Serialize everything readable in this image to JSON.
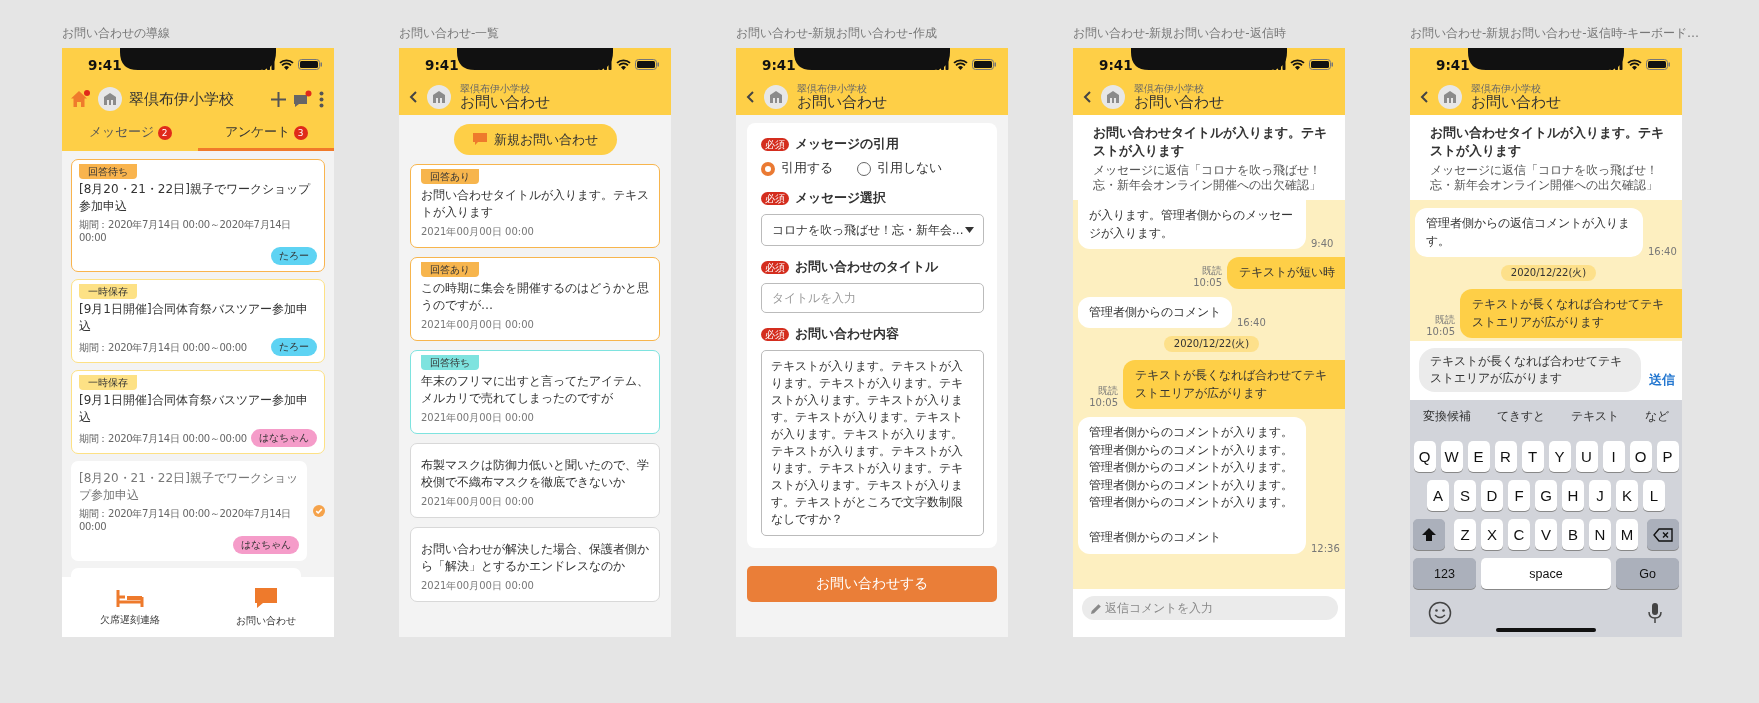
{
  "screens": [
    {
      "kind": "survey_home",
      "caption": "お問い合わせの導線",
      "time": "9:41",
      "school": "翠倶布伊小学校",
      "home_alert": true,
      "chat_alert": true,
      "tabs": [
        {
          "label": "メッセージ",
          "badge": "2",
          "selected": false
        },
        {
          "label": "アンケート",
          "badge": "3",
          "selected": true
        }
      ],
      "cards": [
        {
          "status": "回答待ち",
          "color": "#f9b44e",
          "title": "[8月20・21・22日]親子でワークショップ参加申込",
          "period": "期間：2020年7月14日 00:00～2020年7月14日 00:00",
          "tag": {
            "label": "たろー",
            "color": "#5ed3f3"
          },
          "answered": false
        },
        {
          "status": "一時保存",
          "color": "#fde185",
          "title": "[9月1日開催]合同体育祭バスツアー参加申込",
          "period": "期間：2020年7月14日 00:00～00:00",
          "tag": {
            "label": "たろー",
            "color": "#5ed3f3"
          },
          "answered": false
        },
        {
          "status": "一時保存",
          "color": "#fde185",
          "title": "[9月1日開催]合同体育祭バスツアー参加申込",
          "period": "期間：2020年7月14日 00:00～00:00",
          "tag": {
            "label": "はなちゃん",
            "color": "#f59cc9"
          },
          "answered": false
        },
        {
          "title": "[8月20・21・22日]親子でワークショップ参加申込",
          "period": "期間：2020年7月14日 00:00～2020年7月14日 00:00",
          "tag": {
            "label": "はなちゃん",
            "color": "#f59cc9"
          },
          "answered": true
        }
      ],
      "nav": [
        {
          "kind": "bed",
          "label": "欠席遅刻連絡"
        },
        {
          "kind": "chat",
          "label": "お問い合わせ"
        }
      ]
    },
    {
      "kind": "inquiry_list",
      "caption": "お問い合わせ-一覧",
      "time": "9:41",
      "school": "翠倶布伊小学校",
      "title": "お問い合わせ",
      "new_button": "新規お問い合わせ",
      "items": [
        {
          "status": "回答あり",
          "color": "#f7b54d",
          "title": "お問い合わせタイトルが入ります。テキストが入ります",
          "date": "2021年00月00日 00:00"
        },
        {
          "status": "回答あり",
          "color": "#f7b54d",
          "title": "この時期に集会を開催するのはどうかと思うのですが…",
          "date": "2021年00月00日 00:00"
        },
        {
          "status": "回答待ち",
          "color": "#7ee3df",
          "title": "年末のフリマに出すと言ってたアイテム、メルカリで売れてしまったのですが",
          "date": "2021年00月00日 00:00"
        },
        {
          "title": "布製マスクは防御力低いと聞いたので、学校側で不織布マスクを徹底できないか",
          "date": "2021年00月00日 00:00"
        },
        {
          "title": "お問い合わせが解決した場合、保護者側から「解決」とするかエンドレスなのか",
          "date": "2021年00月00日 00:00"
        }
      ]
    },
    {
      "kind": "form",
      "caption": "お問い合わせ-新規お問い合わせ-作成",
      "time": "9:41",
      "school": "翠倶布伊小学校",
      "title": "お問い合わせ",
      "fields": [
        {
          "kind": "radio",
          "required": "必須",
          "label": "メッセージの引用",
          "options": [
            {
              "label": "引用する",
              "selected": true
            },
            {
              "label": "引用しない",
              "selected": false
            }
          ]
        },
        {
          "kind": "select",
          "required": "必須",
          "label": "メッセージ選択",
          "value": "コロナを吹っ飛ばせ！忘・新年会..."
        },
        {
          "kind": "input",
          "required": "必須",
          "label": "お問い合わせのタイトル",
          "placeholder": "タイトルを入力"
        },
        {
          "kind": "textarea",
          "required": "必須",
          "label": "お問い合わせ内容",
          "value": "テキストが入ります。テキストが入ります。テキストが入ります。テキストが入ります。テキストが入ります。テキストが入ります。テキストが入ります。テキストが入ります。テキストが入ります。テキストが入ります。テキストが入ります。テキストが入ります。テキストが入ります。テキストがところで文字数制限なしですか？"
        }
      ],
      "submit": "お問い合わせする"
    },
    {
      "kind": "chat",
      "caption": "お問い合わせ-新規お問い合わせ-返信時",
      "time": "9:41",
      "school": "翠倶布伊小学校",
      "title": "お問い合わせ",
      "topic": {
        "title": "お問い合わせタイトルが入ります。テキストが入ります",
        "reply_to": "メッセージに返信「コロナを吹っ飛ばせ！忘・新年会オンライン開催への出欠確認」"
      },
      "messages": [
        {
          "kind": "received",
          "paragraphs": [
            "が入ります。管理者側からのメッセージが入ります。"
          ],
          "time": "9:40"
        },
        {
          "kind": "sent",
          "text": "テキストが短い時",
          "read": "既読",
          "time": "10:05"
        },
        {
          "kind": "received",
          "paragraphs": [
            "管理者側からのコメント"
          ],
          "time": "16:40"
        },
        {
          "kind": "date",
          "text": "2020/12/22(火)"
        },
        {
          "kind": "sent",
          "text": "テキストが長くなれば合わせてテキストエリアが広がります",
          "read": "既読",
          "time": "10:05"
        },
        {
          "kind": "received",
          "paragraphs": [
            "管理者側からのコメントが入ります。管理者側からのコメントが入ります。管理者側からのコメントが入ります。管理者側からのコメントが入ります。管理者側からのコメントが入ります。",
            "管理者側からのコメント"
          ],
          "time": "12:36"
        }
      ],
      "compose": {
        "placeholder": "返信コメントを入力"
      }
    },
    {
      "kind": "chat",
      "caption": "お問い合わせ-新規お問い合わせ-返信時-キーボード…",
      "time": "9:41",
      "school": "翠倶布伊小学校",
      "title": "お問い合わせ",
      "topic": {
        "title": "お問い合わせタイトルが入ります。テキストが入ります",
        "reply_to": "メッセージに返信「コロナを吹っ飛ばせ！忘・新年会オンライン開催への出欠確認」"
      },
      "messages": [
        {
          "kind": "received",
          "paragraphs": [
            "管理者側からの返信コメントが入ります。"
          ],
          "time": "16:40"
        },
        {
          "kind": "date",
          "text": "2020/12/22(火)"
        },
        {
          "kind": "sent",
          "text": "テキストが長くなれば合わせてテキストエリアが広がります",
          "read": "既読",
          "time": "10:05"
        }
      ],
      "compose": {
        "value": "テキストが長くなれば合わせてテキストエリアが広がります",
        "send": "送信"
      },
      "keyboard": {
        "suggestions": [
          "変換候補",
          "てきすと",
          "テキスト",
          "など"
        ],
        "rows": [
          [
            "Q",
            "W",
            "E",
            "R",
            "T",
            "Y",
            "U",
            "I",
            "O",
            "P"
          ],
          [
            "A",
            "S",
            "D",
            "F",
            "G",
            "H",
            "J",
            "K",
            "L"
          ],
          [
            "Z",
            "X",
            "C",
            "V",
            "B",
            "N",
            "M"
          ]
        ],
        "numbers": "123",
        "space": "space",
        "go": "Go"
      }
    }
  ]
}
